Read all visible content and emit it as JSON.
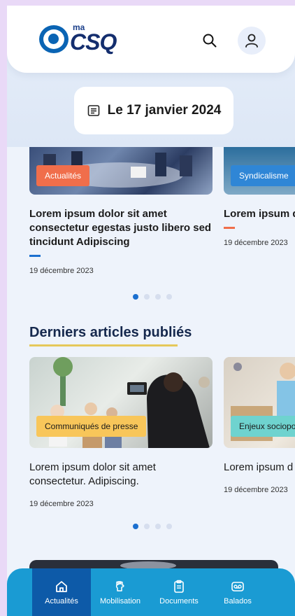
{
  "header": {
    "logo_prefix": "ma",
    "logo_name": "CSQ"
  },
  "date_label": "Le 17 janvier 2024",
  "featured": {
    "cards": [
      {
        "tag": "Actualités",
        "tag_color": "#f06e4b",
        "title": "Lorem ipsum dolor sit amet consectetur egestas justo libero sed tincidunt Adipiscing",
        "accent_color": "#1b6fcf",
        "date": "19 décembre 2023"
      },
      {
        "tag": "Syndicalisme",
        "tag_color": "#2f86d6",
        "title": "Lorem ipsum d consectetur. A",
        "accent_color": "#f06e4b",
        "date": "19 décembre 2023"
      }
    ]
  },
  "latest": {
    "title": "Derniers articles publiés",
    "cards": [
      {
        "tag": "Communiqués de presse",
        "tag_color": "#f8c65a",
        "title": "Lorem ipsum dolor sit amet consectetur. Adipiscing.",
        "date": "19 décembre 2023"
      },
      {
        "tag": "Enjeux sociopo",
        "tag_color": "#6fd3cf",
        "title": "Lorem ipsum d consectetur. A",
        "date": "19 décembre 2023"
      }
    ]
  },
  "nav": {
    "items": [
      {
        "label": "Actualités",
        "icon": "home-icon",
        "active": true
      },
      {
        "label": "Mobilisation",
        "icon": "fist-icon",
        "active": false
      },
      {
        "label": "Documents",
        "icon": "clipboard-icon",
        "active": false
      },
      {
        "label": "Balados",
        "icon": "podcast-icon",
        "active": false
      }
    ]
  },
  "colors": {
    "brand": "#0a64b4",
    "nav_bg": "#1a9bd3",
    "nav_active": "#0d5aa8",
    "section_underline": "#e5c85a"
  }
}
